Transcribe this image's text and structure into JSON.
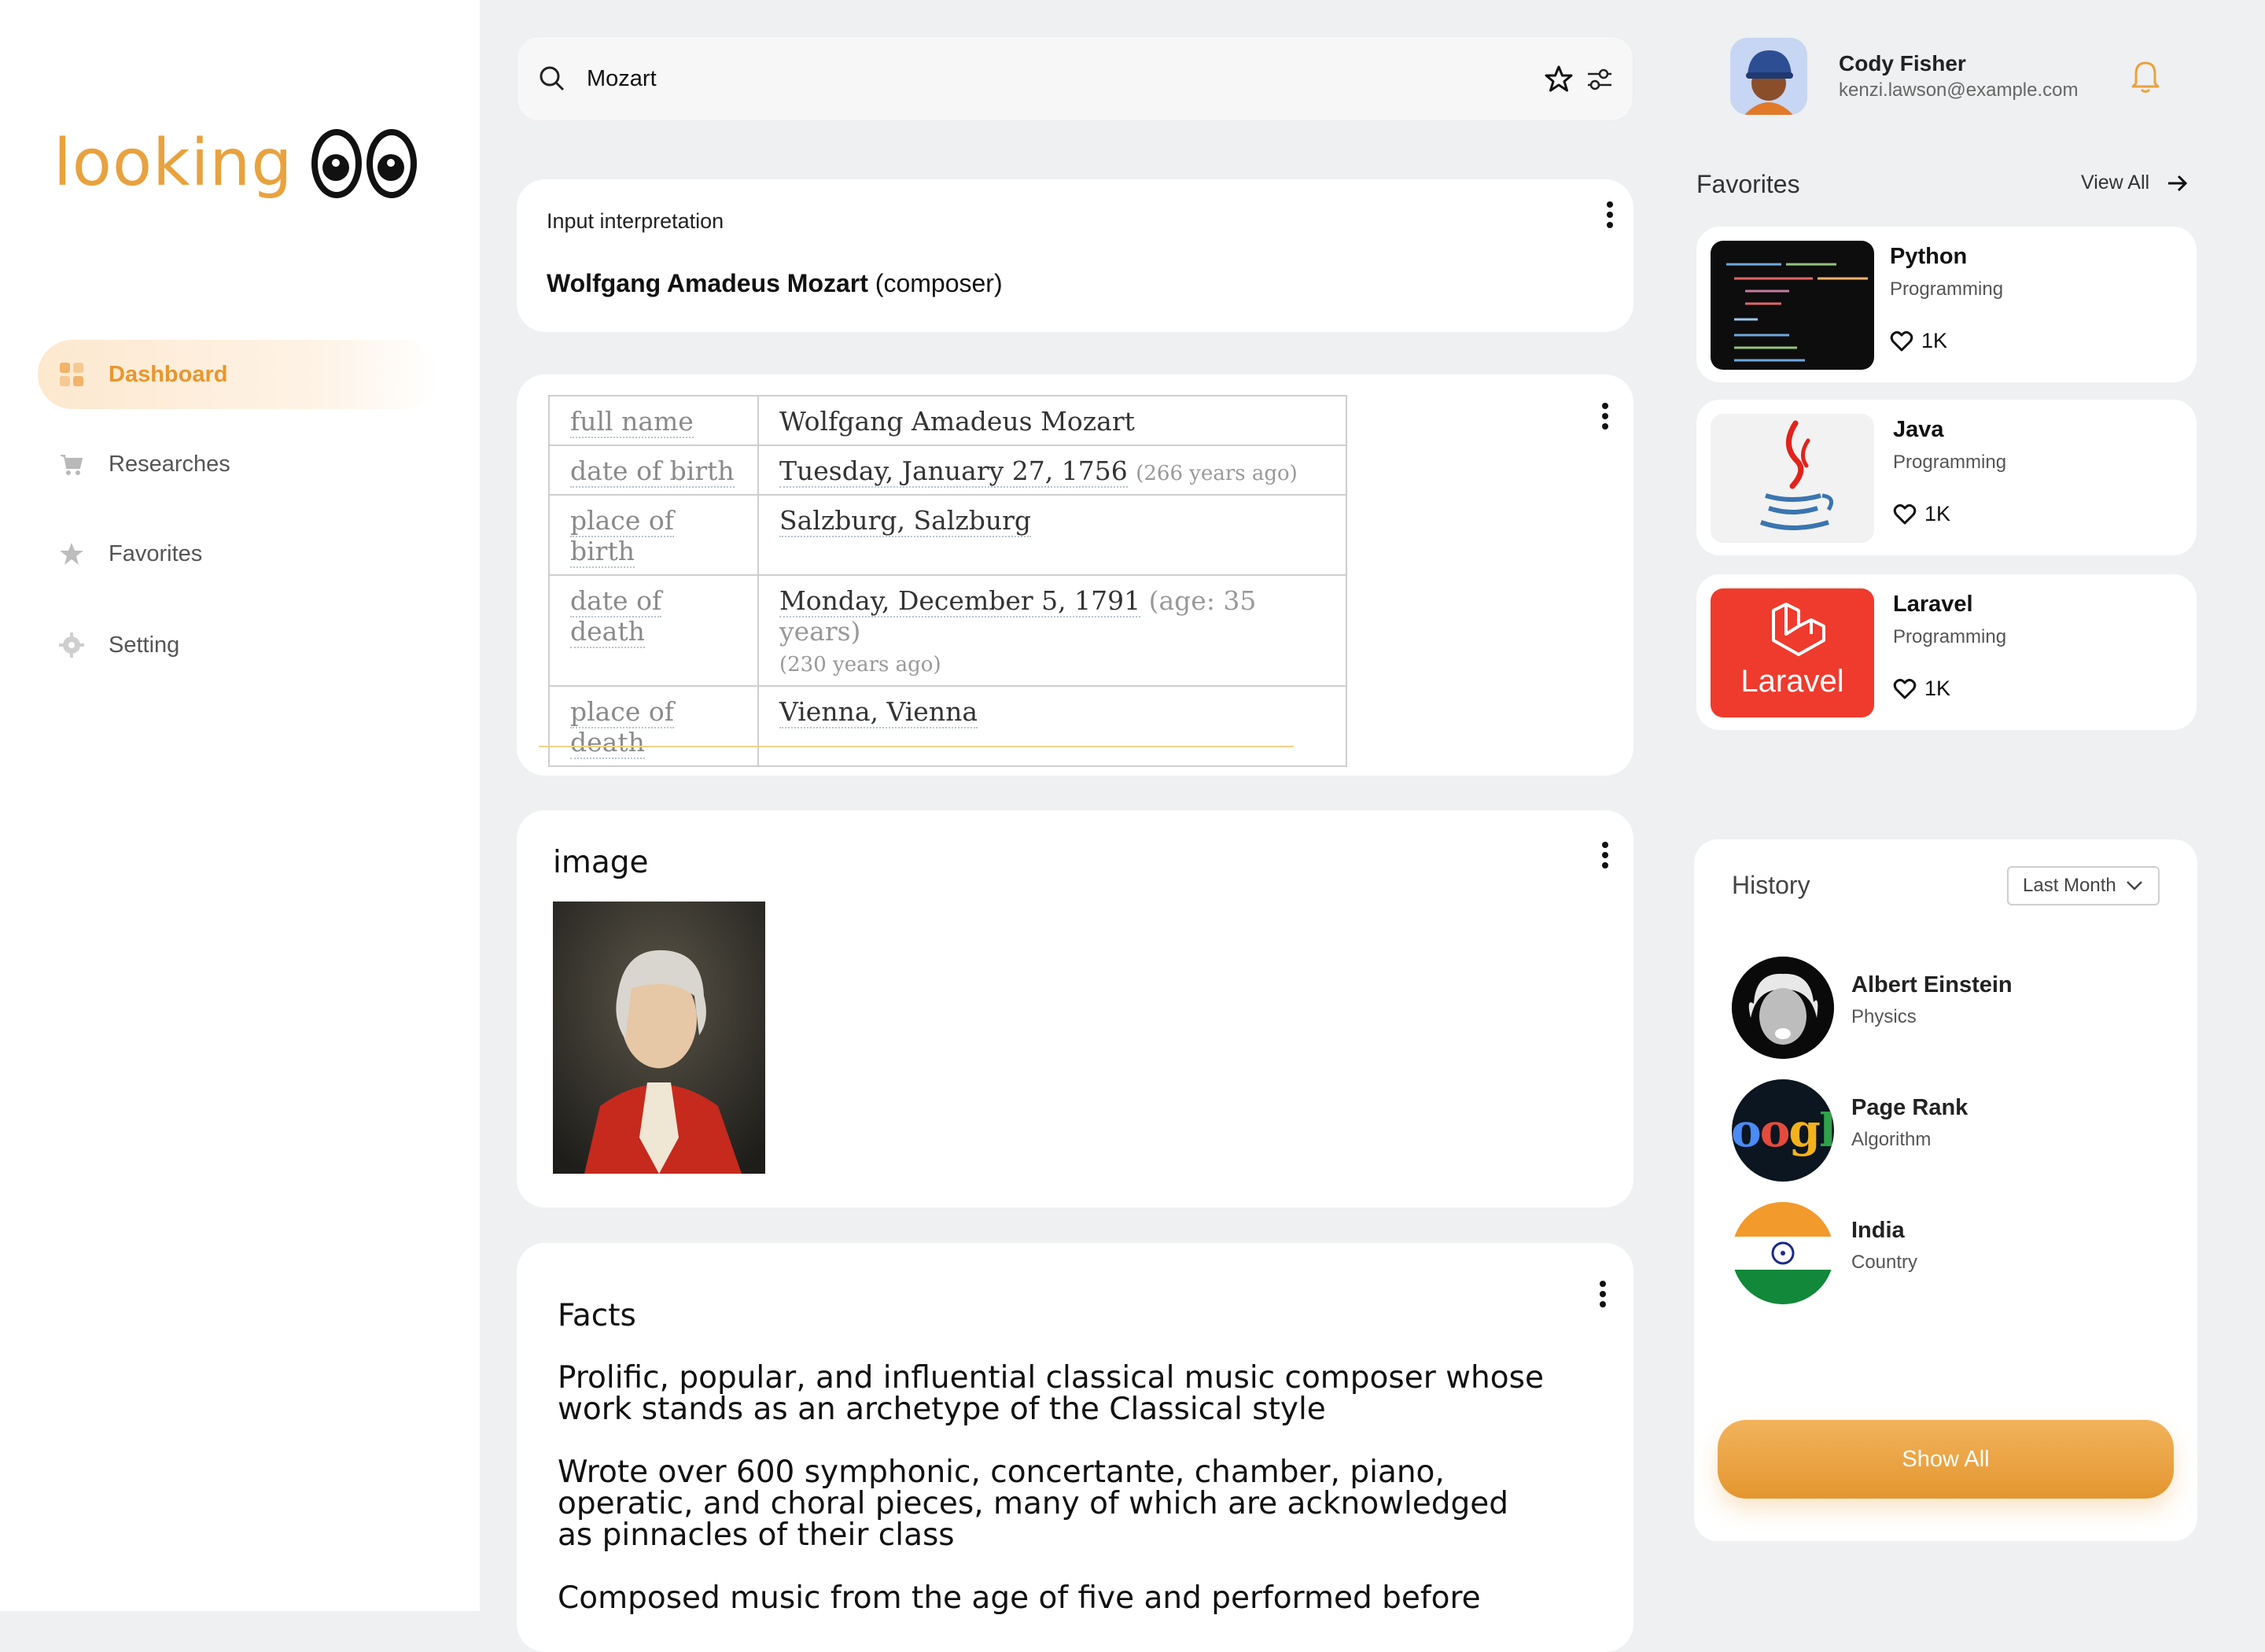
{
  "app": {
    "logo_text": "looking"
  },
  "nav": [
    {
      "label": "Dashboard",
      "icon": "dashboard-grid-icon",
      "active": true
    },
    {
      "label": "Researches",
      "icon": "cart-icon"
    },
    {
      "label": "Favorites",
      "icon": "star-icon"
    },
    {
      "label": "Setting",
      "icon": "gear-icon"
    }
  ],
  "search": {
    "value": "Mozart"
  },
  "user": {
    "name": "Cody Fisher",
    "email": "kenzi.lawson@example.com"
  },
  "interpretation": {
    "heading": "Input interpretation",
    "name": "Wolfgang Amadeus Mozart",
    "qualifier": "(composer)"
  },
  "details": {
    "rows": [
      {
        "key": "full name",
        "value": "Wolfgang Amadeus Mozart",
        "extra": ""
      },
      {
        "key": "date of birth",
        "value": "Tuesday, January 27, 1756",
        "extra": "(266 years ago)"
      },
      {
        "key": "place of birth",
        "value": "Salzburg, Salzburg",
        "extra": ""
      },
      {
        "key": "date of death",
        "value": "Monday, December 5, 1791",
        "extra": "(age: 35 years)",
        "extra2": "(230 years ago)"
      },
      {
        "key": "place of death",
        "value": "Vienna, Vienna",
        "extra": ""
      }
    ]
  },
  "image_card": {
    "heading": "image"
  },
  "facts": {
    "heading": "Facts",
    "items": [
      "Prolific, popular, and influential classical music composer whose work stands as an archetype of the Classical style",
      "Wrote over 600 symphonic, concertante, chamber, piano, operatic, and choral pieces, many of which are acknowledged as pinnacles of their class",
      "Composed music from the age of five and performed before"
    ]
  },
  "favorites": {
    "heading": "Favorites",
    "view_all": "View All",
    "items": [
      {
        "title": "Python",
        "sub": "Programming",
        "likes": "1K"
      },
      {
        "title": "Java",
        "sub": "Programming",
        "likes": "1K"
      },
      {
        "title": "Laravel",
        "sub": "Programming",
        "likes": "1K",
        "thumb_text": "Laravel"
      }
    ]
  },
  "history": {
    "heading": "History",
    "filter": "Last Month",
    "items": [
      {
        "title": "Albert Einstein",
        "sub": "Physics"
      },
      {
        "title": "Page Rank",
        "sub": "Algorithm",
        "thumb_text": "oogl"
      },
      {
        "title": "India",
        "sub": "Country"
      }
    ],
    "show_all": "Show All"
  },
  "colors": {
    "accent": "#e8a23f",
    "background": "#eef0f1",
    "laravel": "#ef3b2d"
  }
}
